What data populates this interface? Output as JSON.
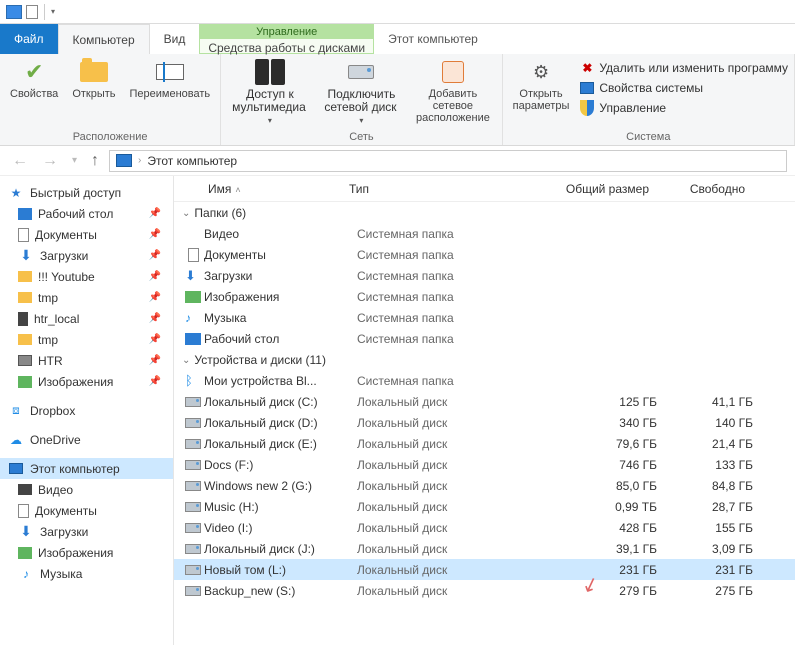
{
  "title": "Этот компьютер",
  "tabs": {
    "file": "Файл",
    "computer": "Компьютер",
    "view": "Вид",
    "context_group": "Управление",
    "context_tab": "Средства работы с дисками"
  },
  "ribbon": {
    "loc": {
      "props": "Свойства",
      "open": "Открыть",
      "rename": "Переименовать",
      "label": "Расположение"
    },
    "net": {
      "media": "Доступ к мультимедиа",
      "map": "Подключить сетевой диск",
      "addnet": "Добавить сетевое расположение",
      "label": "Сеть"
    },
    "sys": {
      "settings": "Открыть параметры",
      "uninstall": "Удалить или изменить программу",
      "sysprops": "Свойства системы",
      "manage": "Управление",
      "label": "Система"
    }
  },
  "breadcrumb": {
    "root": "Этот компьютер"
  },
  "columns": {
    "name": "Имя",
    "type": "Тип",
    "size": "Общий размер",
    "free": "Свободно"
  },
  "sections": {
    "folders": "Папки (6)",
    "drives": "Устройства и диски (11)"
  },
  "sidebar": {
    "quick": "Быстрый доступ",
    "items": [
      {
        "label": "Рабочий стол",
        "cls": "desk",
        "pin": true
      },
      {
        "label": "Документы",
        "cls": "docs",
        "pin": true
      },
      {
        "label": "Загрузки",
        "cls": "down",
        "pin": true
      },
      {
        "label": "!!! Youtube",
        "cls": "fold",
        "pin": true
      },
      {
        "label": "tmp",
        "cls": "fold",
        "pin": true
      },
      {
        "label": "htr_local",
        "cls": "pc",
        "pin": true
      },
      {
        "label": "tmp",
        "cls": "fold",
        "pin": true
      },
      {
        "label": "HTR",
        "cls": "mon",
        "pin": true
      },
      {
        "label": "Изображения",
        "cls": "img",
        "pin": true
      }
    ],
    "dropbox": "Dropbox",
    "onedrive": "OneDrive",
    "thispc": "Этот компьютер",
    "pcitems": [
      {
        "label": "Видео",
        "cls": "vid"
      },
      {
        "label": "Документы",
        "cls": "docs"
      },
      {
        "label": "Загрузки",
        "cls": "down"
      },
      {
        "label": "Изображения",
        "cls": "img"
      },
      {
        "label": "Музыка",
        "cls": "mus"
      }
    ]
  },
  "folders": [
    {
      "name": "Видео",
      "type": "Системная папка",
      "cls": "vid"
    },
    {
      "name": "Документы",
      "type": "Системная папка",
      "cls": "docs"
    },
    {
      "name": "Загрузки",
      "type": "Системная папка",
      "cls": "down"
    },
    {
      "name": "Изображения",
      "type": "Системная папка",
      "cls": "img"
    },
    {
      "name": "Музыка",
      "type": "Системная папка",
      "cls": "mus"
    },
    {
      "name": "Рабочий стол",
      "type": "Системная папка",
      "cls": "desk"
    }
  ],
  "drives": [
    {
      "name": "Мои устройства Bl...",
      "type": "Системная папка",
      "size": "",
      "free": "",
      "cls": "bt"
    },
    {
      "name": "Локальный диск (C:)",
      "type": "Локальный диск",
      "size": "125 ГБ",
      "free": "41,1 ГБ",
      "cls": "hdd"
    },
    {
      "name": "Локальный диск (D:)",
      "type": "Локальный диск",
      "size": "340 ГБ",
      "free": "140 ГБ",
      "cls": "hdd"
    },
    {
      "name": "Локальный диск (E:)",
      "type": "Локальный диск",
      "size": "79,6 ГБ",
      "free": "21,4 ГБ",
      "cls": "hdd"
    },
    {
      "name": "Docs (F:)",
      "type": "Локальный диск",
      "size": "746 ГБ",
      "free": "133 ГБ",
      "cls": "hdd"
    },
    {
      "name": "Windows new 2 (G:)",
      "type": "Локальный диск",
      "size": "85,0 ГБ",
      "free": "84,8 ГБ",
      "cls": "hdd"
    },
    {
      "name": "Music (H:)",
      "type": "Локальный диск",
      "size": "0,99 ТБ",
      "free": "28,7 ГБ",
      "cls": "hdd"
    },
    {
      "name": "Video (I:)",
      "type": "Локальный диск",
      "size": "428 ГБ",
      "free": "155 ГБ",
      "cls": "hdd"
    },
    {
      "name": "Локальный диск (J:)",
      "type": "Локальный диск",
      "size": "39,1 ГБ",
      "free": "3,09 ГБ",
      "cls": "hdd"
    },
    {
      "name": "Новый том (L:)",
      "type": "Локальный диск",
      "size": "231 ГБ",
      "free": "231 ГБ",
      "cls": "hdd",
      "selected": true
    },
    {
      "name": "Backup_new (S:)",
      "type": "Локальный диск",
      "size": "279 ГБ",
      "free": "275 ГБ",
      "cls": "hdd"
    }
  ]
}
